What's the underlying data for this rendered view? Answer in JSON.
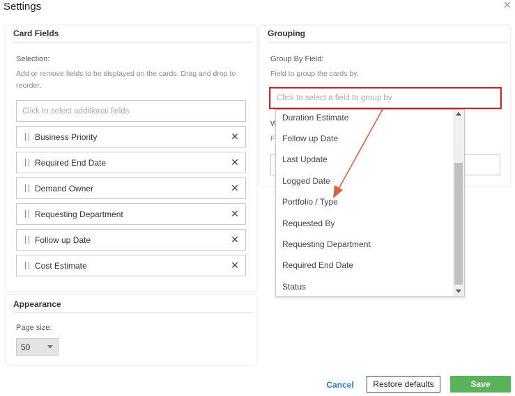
{
  "dialog": {
    "title": "Settings",
    "close_symbol": "✕"
  },
  "card_fields": {
    "title": "Card Fields",
    "selection_label": "Selection:",
    "help_text": "Add or remove fields to be displayed on the cards. Drag and drop to reorder.",
    "add_placeholder": "Click to select additional fields",
    "fields": [
      {
        "label": "Business Priority"
      },
      {
        "label": "Required End Date"
      },
      {
        "label": "Demand Owner"
      },
      {
        "label": "Requesting Department"
      },
      {
        "label": "Follow up Date"
      },
      {
        "label": "Cost Estimate"
      }
    ],
    "remove_symbol": "✕"
  },
  "appearance": {
    "title": "Appearance",
    "page_size_label": "Page size:",
    "page_size_value": "50"
  },
  "grouping": {
    "title": "Grouping",
    "group_by_label": "Group By Field:",
    "group_by_help": "Field to group the cards by.",
    "group_by_placeholder": "Click to select a field to group by",
    "hidden_label_fragment": "W",
    "hidden_help_fragment": "F",
    "dropdown_options": [
      "Duration Estimate",
      "Follow up Date",
      "Last Update",
      "Logged Date",
      "Portfolio / Type",
      "Requested By",
      "Requesting Department",
      "Required End Date",
      "Status"
    ]
  },
  "footer": {
    "cancel_label": "Cancel",
    "restore_label": "Restore defaults",
    "save_label": "Save"
  },
  "colors": {
    "accent_link": "#2a7fc0",
    "save_green": "#5cb25c",
    "highlight_red": "#d9232d",
    "arrow": "#d9603e"
  }
}
